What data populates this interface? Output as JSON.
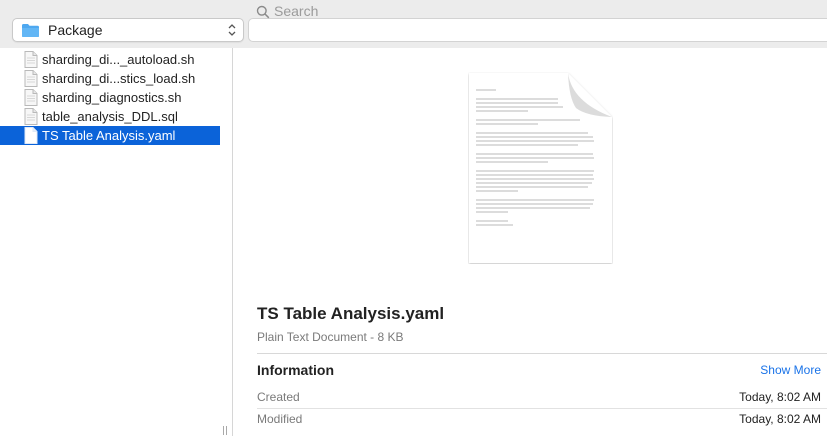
{
  "toolbar": {
    "location_label": "Package",
    "search_placeholder": "Search"
  },
  "files": [
    {
      "label": "sharding_di..._autoload.sh",
      "selected": false
    },
    {
      "label": "sharding_di...stics_load.sh",
      "selected": false
    },
    {
      "label": "sharding_diagnostics.sh",
      "selected": false
    },
    {
      "label": "table_analysis_DDL.sql",
      "selected": false
    },
    {
      "label": "TS Table Analysis.yaml",
      "selected": true
    }
  ],
  "preview": {
    "title": "TS Table Analysis.yaml",
    "subtitle": "Plain Text Document - 8 KB",
    "info_heading": "Information",
    "show_more_label": "Show More",
    "created_label": "Created",
    "created_value": "Today, 8:02 AM",
    "modified_label": "Modified",
    "modified_value": "Today, 8:02 AM"
  },
  "icons": {
    "folder": "folder-icon",
    "stepper": "chevron-up-down-icon",
    "search": "search-icon",
    "document": "document-icon"
  },
  "colors": {
    "selection": "#0b63d9",
    "link": "#1a73e8",
    "folder": "#4ea8f0"
  }
}
